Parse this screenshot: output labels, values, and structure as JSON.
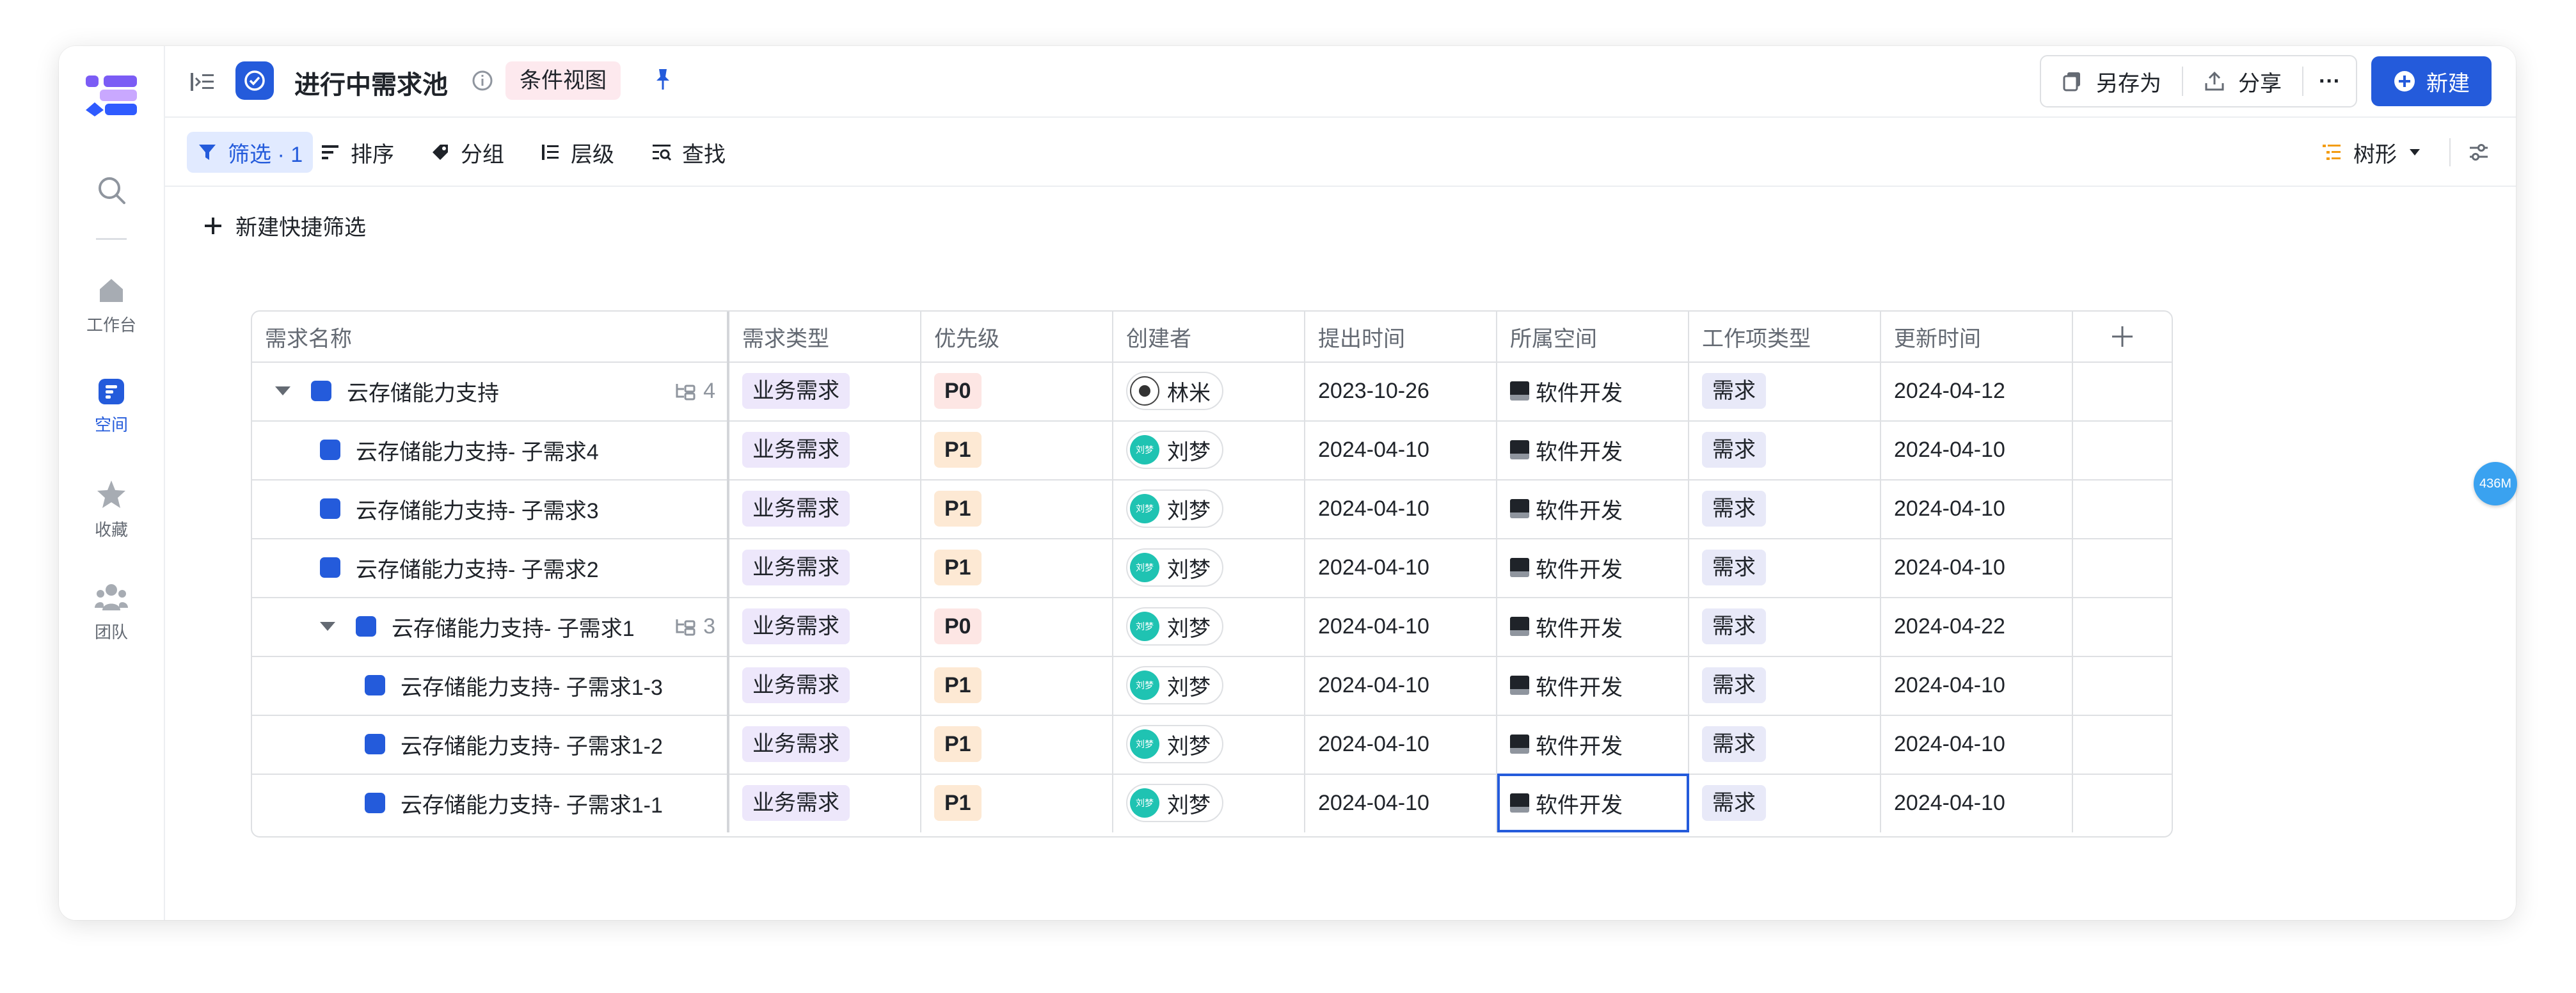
{
  "sidebar": {
    "items": [
      {
        "icon": "search-icon",
        "label": ""
      },
      {
        "icon": "home-icon",
        "label": "工作台"
      },
      {
        "icon": "space-icon",
        "label": "空间"
      },
      {
        "icon": "star-icon",
        "label": "收藏"
      },
      {
        "icon": "team-icon",
        "label": "团队"
      }
    ]
  },
  "header": {
    "title": "进行中需求池",
    "view_badge": "条件视图",
    "save_as": "另存为",
    "share": "分享",
    "more": "···",
    "new": "新建"
  },
  "toolbar": {
    "filter": "筛选 · 1",
    "sort": "排序",
    "group": "分组",
    "level": "层级",
    "find": "查找",
    "view_mode": "树形"
  },
  "quick_filter": "新建快捷筛选",
  "table": {
    "columns": [
      "需求名称",
      "需求类型",
      "优先级",
      "创建者",
      "提出时间",
      "所属空间",
      "工作项类型",
      "更新时间"
    ],
    "rows": [
      {
        "name": "云存储能力支持",
        "subcount": "4",
        "type": "业务需求",
        "priority": "P0",
        "creator": "林米",
        "created": "2023-10-26",
        "space": "软件开发",
        "kind": "需求",
        "updated": "2024-04-12"
      },
      {
        "name": "云存储能力支持- 子需求4",
        "subcount": "",
        "type": "业务需求",
        "priority": "P1",
        "creator": "刘梦",
        "created": "2024-04-10",
        "space": "软件开发",
        "kind": "需求",
        "updated": "2024-04-10"
      },
      {
        "name": "云存储能力支持- 子需求3",
        "subcount": "",
        "type": "业务需求",
        "priority": "P1",
        "creator": "刘梦",
        "created": "2024-04-10",
        "space": "软件开发",
        "kind": "需求",
        "updated": "2024-04-10"
      },
      {
        "name": "云存储能力支持- 子需求2",
        "subcount": "",
        "type": "业务需求",
        "priority": "P1",
        "creator": "刘梦",
        "created": "2024-04-10",
        "space": "软件开发",
        "kind": "需求",
        "updated": "2024-04-10"
      },
      {
        "name": "云存储能力支持- 子需求1",
        "subcount": "3",
        "type": "业务需求",
        "priority": "P0",
        "creator": "刘梦",
        "created": "2024-04-10",
        "space": "软件开发",
        "kind": "需求",
        "updated": "2024-04-22"
      },
      {
        "name": "云存储能力支持- 子需求1-3",
        "subcount": "",
        "type": "业务需求",
        "priority": "P1",
        "creator": "刘梦",
        "created": "2024-04-10",
        "space": "软件开发",
        "kind": "需求",
        "updated": "2024-04-10"
      },
      {
        "name": "云存储能力支持- 子需求1-2",
        "subcount": "",
        "type": "业务需求",
        "priority": "P1",
        "creator": "刘梦",
        "created": "2024-04-10",
        "space": "软件开发",
        "kind": "需求",
        "updated": "2024-04-10"
      },
      {
        "name": "云存储能力支持- 子需求1-1",
        "subcount": "",
        "type": "业务需求",
        "priority": "P1",
        "creator": "刘梦",
        "created": "2024-04-10",
        "space": "软件开发",
        "kind": "需求",
        "updated": "2024-04-10"
      }
    ]
  },
  "avatar_text": "刘梦",
  "memory_badge": "436M",
  "colors": {
    "accent": "#245bdb",
    "p0_bg": "#fde6e4",
    "p1_bg": "#fde9d4",
    "type_bg": "#ede7fb"
  }
}
